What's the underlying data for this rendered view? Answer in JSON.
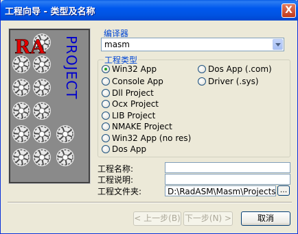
{
  "window": {
    "title": "工程向导 - 类型及名称",
    "close_label": "X"
  },
  "banner": {
    "logo_text": "RA",
    "vertical_text": "PROJECT"
  },
  "compiler": {
    "label": "编译器",
    "value": "masm"
  },
  "project_type": {
    "label": "工程类型",
    "options": [
      {
        "label": "Win32 App",
        "selected": true
      },
      {
        "label": "Console App",
        "selected": false
      },
      {
        "label": "Dll Project",
        "selected": false
      },
      {
        "label": "Ocx Project",
        "selected": false
      },
      {
        "label": "LIB Project",
        "selected": false
      },
      {
        "label": "NMAKE Project",
        "selected": false
      },
      {
        "label": "Win32 App (no res)",
        "selected": false
      },
      {
        "label": "Dos App",
        "selected": false
      },
      {
        "label": "Dos App (.com)",
        "selected": false
      },
      {
        "label": "Driver (.sys)",
        "selected": false
      }
    ]
  },
  "fields": {
    "name_label": "工程名称:",
    "name_value": "",
    "desc_label": "工程说明:",
    "desc_value": "",
    "folder_label": "工程文件夹:",
    "folder_value": "D:\\RadASM\\Masm\\Projects",
    "browse_label": "..."
  },
  "buttons": {
    "back": "< 上一步(B)",
    "next": "下一步(N) >",
    "cancel": "取消"
  }
}
